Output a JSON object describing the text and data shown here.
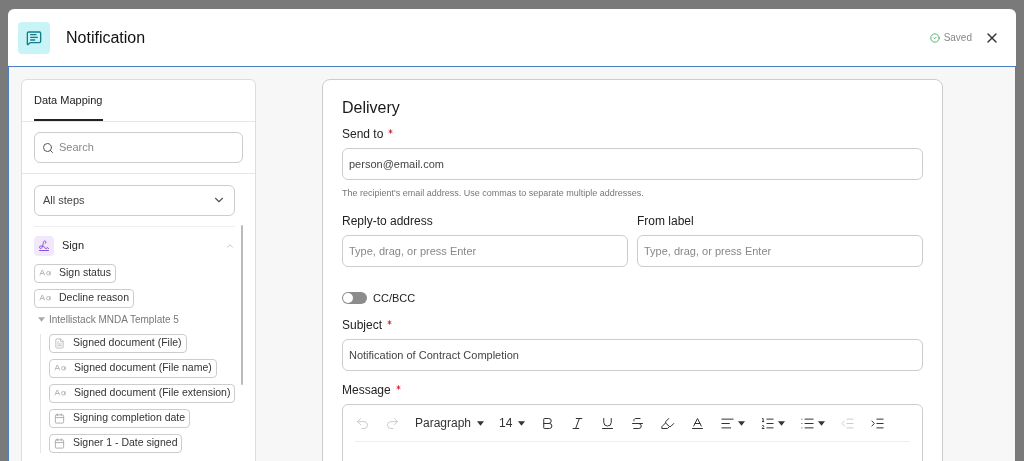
{
  "dialog": {
    "title": "Notification",
    "status": "Saved"
  },
  "sidebar": {
    "tabs": [
      {
        "label": "Data Mapping",
        "selected": true
      }
    ],
    "search": {
      "placeholder": "Search"
    },
    "step_filter": {
      "value": "All steps"
    },
    "groups": [
      {
        "title": "Sign",
        "expanded": true,
        "fields": [
          {
            "kind": "text",
            "label": "Sign status"
          },
          {
            "kind": "text",
            "label": "Decline reason"
          }
        ],
        "children": [
          {
            "title": "Intellistack MNDA Template 5",
            "expanded": true,
            "fields": [
              {
                "kind": "file",
                "label": "Signed document (File)"
              },
              {
                "kind": "text",
                "label": "Signed document (File name)"
              },
              {
                "kind": "text",
                "label": "Signed document (File extension)"
              },
              {
                "kind": "date",
                "label": "Signing completion date"
              },
              {
                "kind": "date",
                "label": "Signer 1 - Date signed"
              }
            ]
          }
        ]
      }
    ]
  },
  "form": {
    "title": "Delivery",
    "send_to": {
      "label": "Send to",
      "required": true,
      "value": "person@email.com",
      "help": "The recipient's email address. Use commas to separate multiple addresses."
    },
    "reply_to": {
      "label": "Reply-to address",
      "required": false,
      "placeholder": "Type, drag, or press Enter"
    },
    "from_label": {
      "label": "From label",
      "required": false,
      "placeholder": "Type, drag, or press Enter"
    },
    "cc_bcc": {
      "label": "CC/BCC",
      "on": false
    },
    "subject": {
      "label": "Subject",
      "required": true,
      "value": "Notification of Contract Completion"
    },
    "message": {
      "label": "Message",
      "required": true,
      "toolbar": [
        {
          "kind": "undo",
          "disabled": true
        },
        {
          "kind": "redo",
          "disabled": true
        },
        {
          "kind": "select",
          "text": "Paragraph",
          "disabled": false
        },
        {
          "kind": "select",
          "text": "14",
          "disabled": false
        },
        {
          "kind": "bold",
          "disabled": false
        },
        {
          "kind": "italic",
          "disabled": false
        },
        {
          "kind": "underline",
          "disabled": false
        },
        {
          "kind": "strike",
          "disabled": false
        },
        {
          "kind": "highlight",
          "disabled": false
        },
        {
          "kind": "color",
          "disabled": false
        },
        {
          "kind": "align",
          "disabled": false
        },
        {
          "kind": "ordered",
          "disabled": false
        },
        {
          "kind": "bullets",
          "disabled": false
        },
        {
          "kind": "outdent",
          "disabled": true
        },
        {
          "kind": "indent",
          "disabled": false
        }
      ]
    }
  }
}
